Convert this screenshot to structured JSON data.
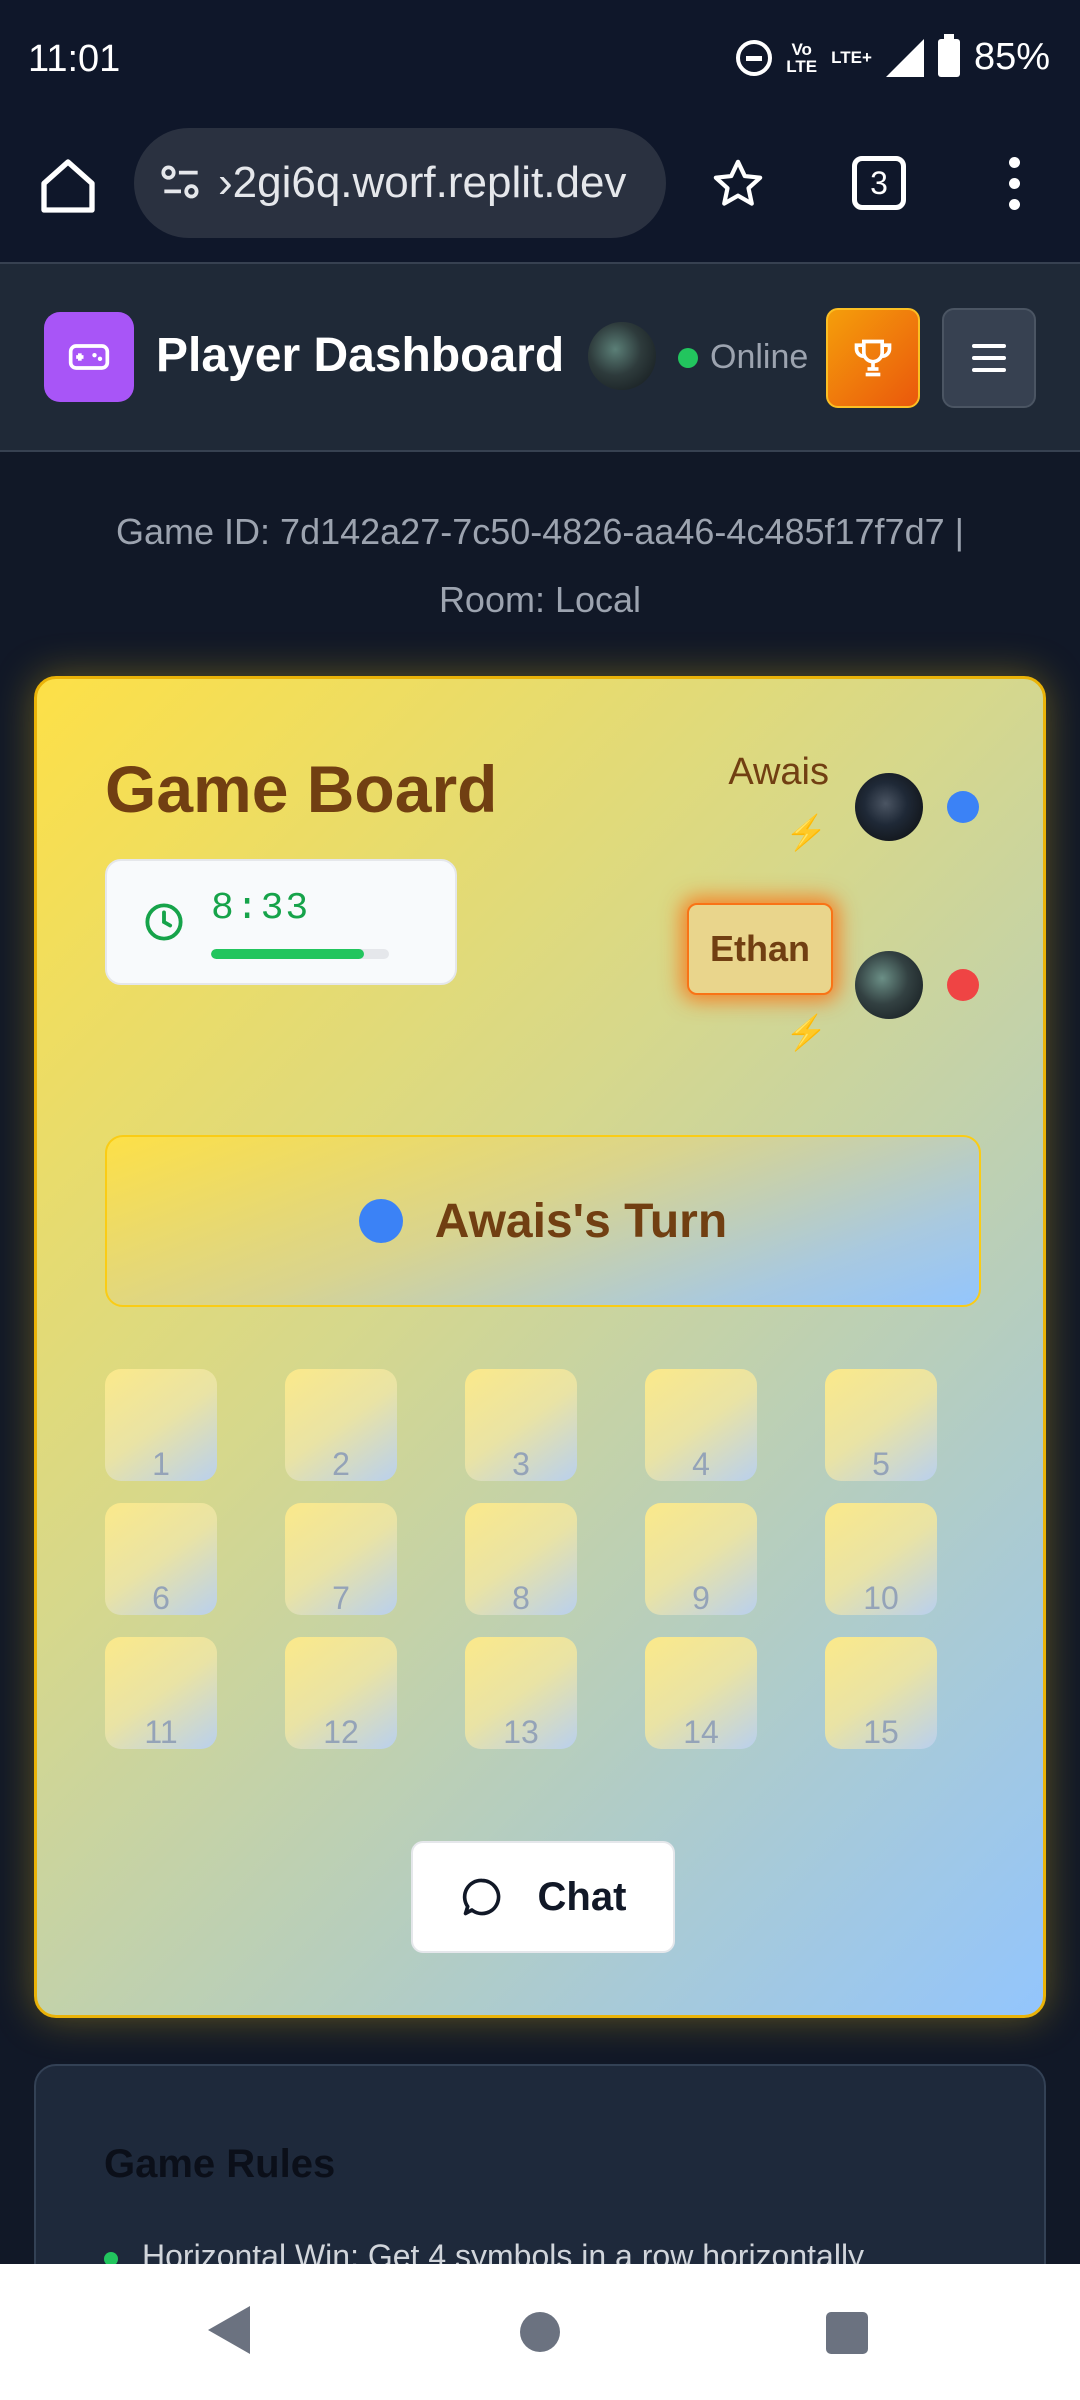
{
  "status_bar": {
    "time": "11:01",
    "network_top": "Vo",
    "network_bottom": "LTE",
    "lte": "LTE+",
    "battery": "85%"
  },
  "browser": {
    "url": "›2gi6q.worf.replit.dev",
    "tab_count": "3"
  },
  "header": {
    "title": "Player Dashboard",
    "status": "Online",
    "status_color": "#22c55e",
    "logo_color": "#a855f7"
  },
  "game_info": {
    "line1": "Game ID: 7d142a27-7c50-4826-aa46-4c485f17f7d7 |",
    "line2": "Room: Local"
  },
  "board": {
    "title": "Game Board",
    "timer": "8:33",
    "timer_progress": 0.86,
    "players": [
      {
        "name": "Awais",
        "color": "#3b82f6",
        "bolt": "⚡"
      },
      {
        "name": "Ethan",
        "color": "#ef4444",
        "bolt": "⚡"
      }
    ],
    "turn_text": "Awais's Turn",
    "cells": [
      "1",
      "2",
      "3",
      "4",
      "5",
      "6",
      "7",
      "8",
      "9",
      "10",
      "11",
      "12",
      "13",
      "14",
      "15"
    ],
    "chat_label": "Chat"
  },
  "rules": {
    "title": "Game Rules",
    "items": [
      "Horizontal Win: Get 4 symbols in a row horizontally"
    ]
  }
}
